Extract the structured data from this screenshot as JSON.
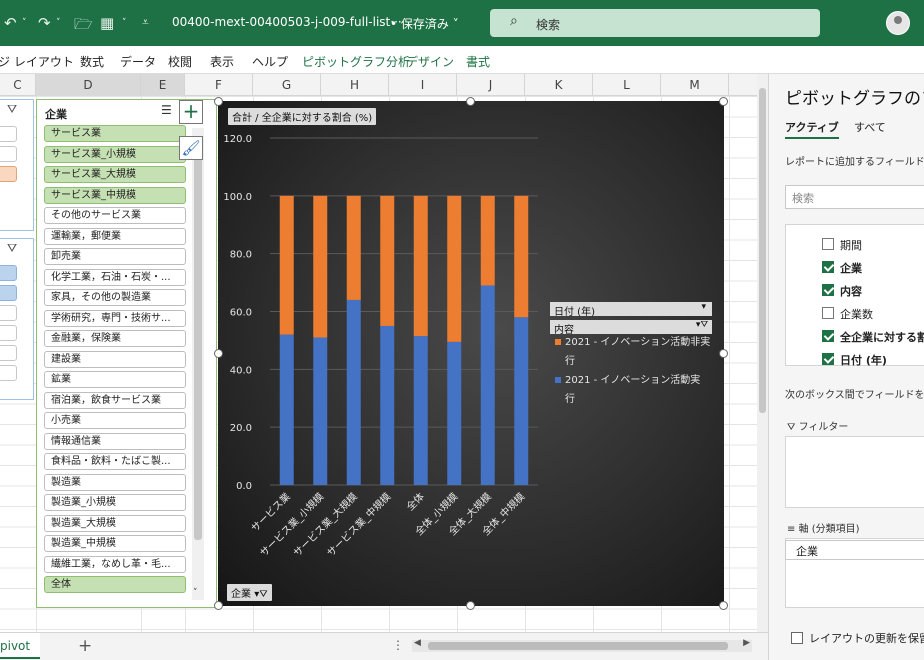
{
  "titlebar": {
    "doc_title": "00400-mext-00400503-j-009-full-list···",
    "saved": "• 保存済み ˅",
    "search_placeholder": "検索",
    "undo_icon": "undo-icon",
    "redo_icon": "redo-icon"
  },
  "ribbon": {
    "tabs": [
      "ジ レイアウト",
      "数式",
      "データ",
      "校閲",
      "表示",
      "ヘルプ",
      "ピボットグラフ分析",
      "デザイン",
      "書式"
    ]
  },
  "columns": [
    "C",
    "D",
    "E",
    "F",
    "G",
    "H",
    "I",
    "J",
    "K",
    "L",
    "M"
  ],
  "slicer": {
    "title": "企業",
    "items": [
      {
        "label": "サービス業",
        "selected": true
      },
      {
        "label": "サービス業_小規模",
        "selected": true
      },
      {
        "label": "サービス業_大規模",
        "selected": true
      },
      {
        "label": "サービス業_中規模",
        "selected": true
      },
      {
        "label": "その他のサービス業",
        "selected": false
      },
      {
        "label": "運輸業，郵便業",
        "selected": false
      },
      {
        "label": "卸売業",
        "selected": false
      },
      {
        "label": "化学工業，石油・石炭・...",
        "selected": false
      },
      {
        "label": "家具，その他の製造業",
        "selected": false
      },
      {
        "label": "学術研究，専門・技術サ...",
        "selected": false
      },
      {
        "label": "金融業，保険業",
        "selected": false
      },
      {
        "label": "建設業",
        "selected": false
      },
      {
        "label": "鉱業",
        "selected": false
      },
      {
        "label": "宿泊業，飲食サービス業",
        "selected": false
      },
      {
        "label": "小売業",
        "selected": false
      },
      {
        "label": "情報通信業",
        "selected": false
      },
      {
        "label": "食料品・飲料・たばこ製...",
        "selected": false
      },
      {
        "label": "製造業",
        "selected": false
      },
      {
        "label": "製造業_小規模",
        "selected": false
      },
      {
        "label": "製造業_大規模",
        "selected": false
      },
      {
        "label": "製造業_中規模",
        "selected": false
      },
      {
        "label": "繊維工業，なめし革・毛...",
        "selected": false
      },
      {
        "label": "全体",
        "selected": true
      }
    ]
  },
  "chart_data": {
    "type": "bar",
    "stacked": true,
    "title": "合計 / 全企業に対する割合 (%)",
    "categories": [
      "サービス業",
      "サービス業_小規模",
      "サービス業_大規模",
      "サービス業_中規模",
      "全体",
      "全体_小規模",
      "全体_大規模",
      "全体_中規模"
    ],
    "series": [
      {
        "name": "2021 - イノベーション活動実行",
        "color": "#4472c4",
        "values": [
          52,
          51,
          64,
          55,
          51.5,
          49.5,
          69,
          58
        ]
      },
      {
        "name": "2021 - イノベーション活動非実行",
        "color": "#ed7d31",
        "values": [
          48,
          49,
          36,
          45,
          48.5,
          50.5,
          31,
          42
        ]
      }
    ],
    "ylim": [
      0,
      120
    ],
    "yticks": [
      "0.0",
      "20.0",
      "40.0",
      "60.0",
      "80.0",
      "100.0",
      "120.0"
    ],
    "legend_position": "right",
    "legend_header_date": "日付 (年)",
    "legend_header_field": "内容",
    "axis_field_button": "企業"
  },
  "pane": {
    "title": "ピボットグラフのフィ",
    "tabs": [
      "アクティブ",
      "すべて"
    ],
    "hint": "レポートに追加するフィールドを選",
    "search_placeholder": "検索",
    "fields": [
      {
        "label": "期間",
        "checked": false
      },
      {
        "label": "企業",
        "checked": true
      },
      {
        "label": "内容",
        "checked": true
      },
      {
        "label": "企業数",
        "checked": false
      },
      {
        "label": "全企業に対する割",
        "checked": true
      },
      {
        "label": "日付 (年)",
        "checked": true
      }
    ],
    "drag_hint": "次のボックス間でフィールドをドラ",
    "filter_label": "フィルター",
    "axis_label": "軸 (分類項目)",
    "axis_chip": "企業",
    "defer_label": "レイアウトの更新を保留す"
  },
  "sheetbar": {
    "tab": "pivot",
    "add": "+"
  }
}
